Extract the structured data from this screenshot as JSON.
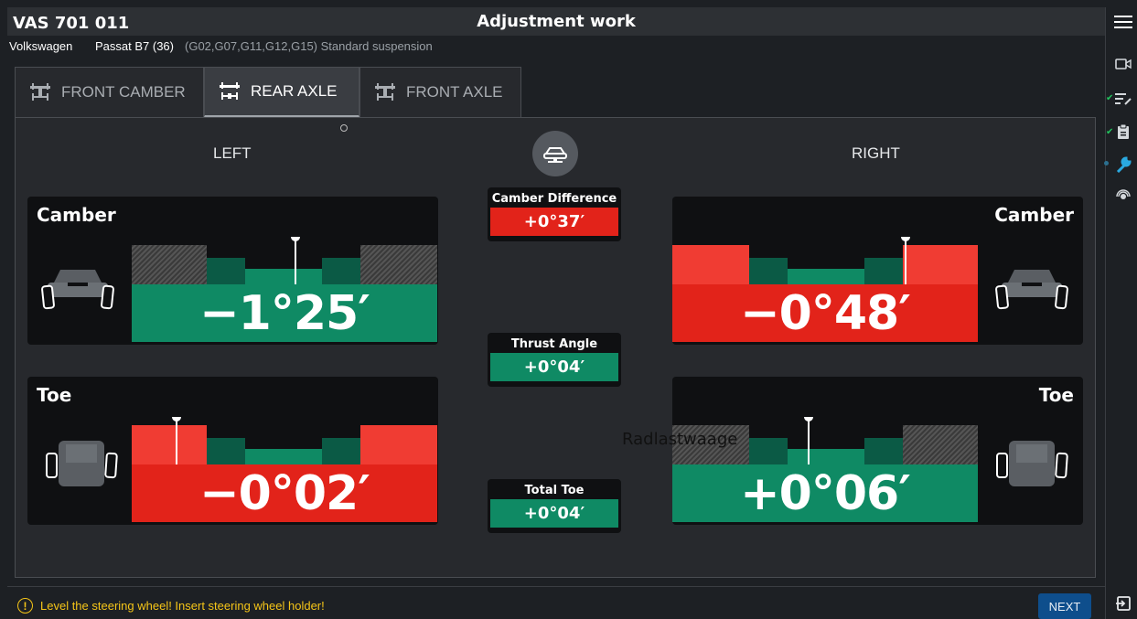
{
  "header": {
    "app_id": "VAS 701 011",
    "title": "Adjustment work"
  },
  "vehicle": {
    "make": "Volkswagen",
    "model": "Passat B7 (36)",
    "suspension": "(G02,G07,G11,G12,G15) Standard suspension"
  },
  "tabs": [
    {
      "label": "FRONT CAMBER",
      "active": false
    },
    {
      "label": "REAR AXLE",
      "active": true
    },
    {
      "label": "FRONT AXLE",
      "active": false
    }
  ],
  "sides": {
    "left": "LEFT",
    "right": "RIGHT"
  },
  "measurements": {
    "left_camber": {
      "title": "Camber",
      "value": "−1°25′",
      "status": "in-tolerance"
    },
    "right_camber": {
      "title": "Camber",
      "value": "−0°48′",
      "status": "out-of-tolerance"
    },
    "left_toe": {
      "title": "Toe",
      "value": "−0°02′",
      "status": "out-of-tolerance"
    },
    "right_toe": {
      "title": "Toe",
      "value": "+0°06′",
      "status": "in-tolerance"
    }
  },
  "center": {
    "camber_difference": {
      "label": "Camber Difference",
      "value": "+0°37′"
    },
    "thrust_angle": {
      "label": "Thrust Angle",
      "value": "+0°04′"
    },
    "total_toe": {
      "label": "Total Toe",
      "value": "+0°04′"
    }
  },
  "overlay_text": "Radlastwaage",
  "footer": {
    "warning": "Level the steering wheel! Insert steering wheel holder!",
    "next_label": "NEXT"
  },
  "colors": {
    "green": "#0f8a64",
    "dark_green": "#0b5a45",
    "red": "#e2231a",
    "bright_red": "#f03c33",
    "accent_blue": "#2aa9e0"
  },
  "icons": [
    "menu-icon",
    "camera-icon",
    "edit-list-icon",
    "clipboard-icon",
    "wrench-icon",
    "sensor-icon",
    "exit-icon",
    "car-lift-icon"
  ]
}
